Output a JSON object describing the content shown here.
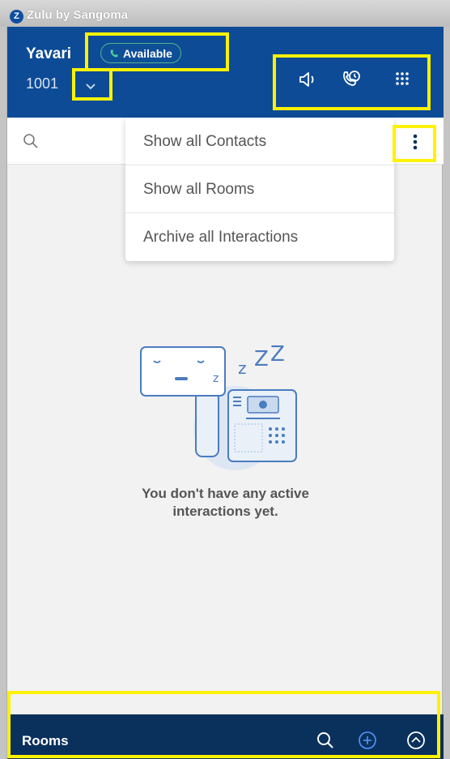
{
  "window": {
    "title": "Zulu by Sangoma",
    "logo_letter": "Z"
  },
  "header": {
    "user_name": "Yavari",
    "status": "Available",
    "extension": "1001",
    "icons": [
      "speaker-icon",
      "call-history-icon",
      "dialpad-icon"
    ]
  },
  "search": {
    "icon": "search-icon"
  },
  "menu": {
    "items": [
      {
        "label": "Show all Contacts"
      },
      {
        "label": "Show all Rooms"
      },
      {
        "label": "Archive all Interactions"
      }
    ]
  },
  "empty_state": {
    "line1": "You don't have any active",
    "line2": "interactions yet."
  },
  "footer": {
    "title": "Rooms",
    "icons": [
      "search-icon",
      "add-circle-icon",
      "chevron-up-circle-icon"
    ]
  },
  "colors": {
    "header_bg": "#0d4b97",
    "footer_bg": "#0a305c",
    "highlight": "#fff200",
    "available": "#4fb58b"
  }
}
